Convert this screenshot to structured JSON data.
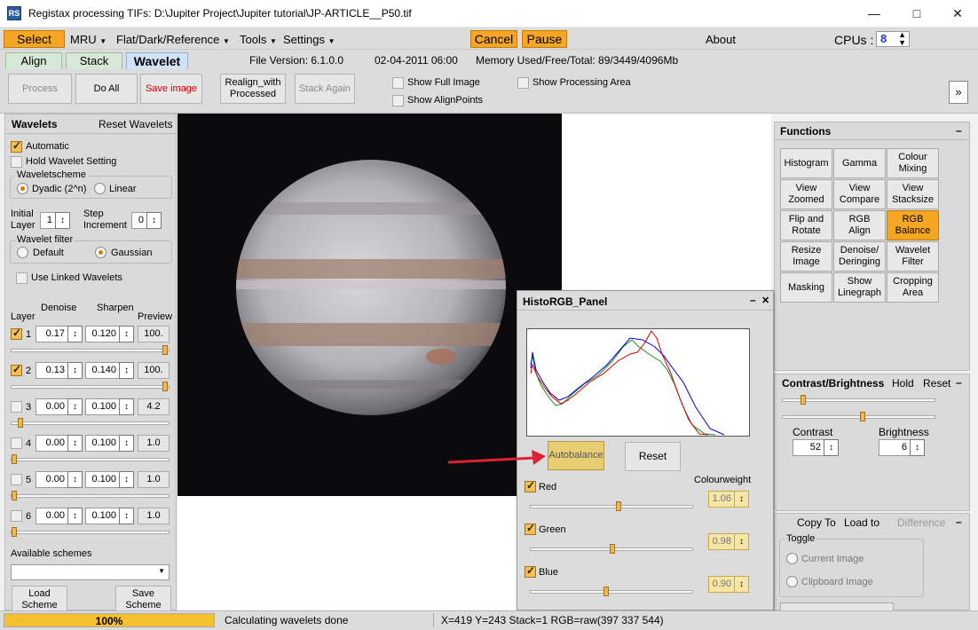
{
  "window": {
    "title": "Registax processing TIFs: D:\\Jupiter Project\\Jupiter tutorial\\JP-ARTICLE__P50.tif",
    "icon_label": "RS"
  },
  "menubar": {
    "select": "Select",
    "mru": "MRU",
    "flat": "Flat/Dark/Reference",
    "tools": "Tools",
    "settings": "Settings",
    "cancel": "Cancel",
    "pause": "Pause",
    "about": "About",
    "cpus_label": "CPUs :",
    "cpus_value": "8"
  },
  "tabs": {
    "align": "Align",
    "stack": "Stack",
    "wavelet": "Wavelet",
    "file_version": "File Version: 6.1.0.0",
    "date": "02-04-2011 06:00",
    "memory": "Memory Used/Free/Total: 89/3449/4096Mb"
  },
  "toolbar": {
    "process": "Process",
    "do_all": "Do All",
    "save_image": "Save image",
    "realign_line1": "Realign_with",
    "realign_line2": "Processed",
    "stack_again": "Stack Again",
    "show_full_image": "Show Full Image",
    "show_alignpoints": "Show AlignPoints",
    "show_processing_area": "Show Processing Area",
    "expand": "»"
  },
  "wavelets": {
    "title": "Wavelets",
    "reset": "Reset Wavelets",
    "automatic": "Automatic",
    "hold": "Hold Wavelet Setting",
    "scheme_title": "Waveletscheme",
    "dyadic": "Dyadic (2^n)",
    "linear": "Linear",
    "initial_layer_1": "Initial",
    "initial_layer_2": "Layer",
    "initial_value": "1",
    "step_1": "Step",
    "step_2": "Increment",
    "step_value": "0",
    "filter_title": "Wavelet filter",
    "default": "Default",
    "gaussian": "Gaussian",
    "use_linked": "Use Linked Wavelets",
    "col_layer": "Layer",
    "col_denoise": "Denoise",
    "col_sharpen": "Sharpen",
    "col_preview": "Preview",
    "layers": [
      {
        "n": "1",
        "denoise": "0.17",
        "sharpen": "0.120",
        "preview": "100.",
        "checked": true,
        "slider": 1.0
      },
      {
        "n": "2",
        "denoise": "0.13",
        "sharpen": "0.140",
        "preview": "100.",
        "checked": true,
        "slider": 1.0
      },
      {
        "n": "3",
        "denoise": "0.00",
        "sharpen": "0.100",
        "preview": "4.2",
        "checked": false,
        "slider": 0.04
      },
      {
        "n": "4",
        "denoise": "0.00",
        "sharpen": "0.100",
        "preview": "1.0",
        "checked": false,
        "slider": 0.0
      },
      {
        "n": "5",
        "denoise": "0.00",
        "sharpen": "0.100",
        "preview": "1.0",
        "checked": false,
        "slider": 0.0
      },
      {
        "n": "6",
        "denoise": "0.00",
        "sharpen": "0.100",
        "preview": "1.0",
        "checked": false,
        "slider": 0.0
      }
    ],
    "available_schemes": "Available schemes",
    "load_1": "Load",
    "load_2": "Scheme",
    "save_1": "Save",
    "save_2": "Scheme"
  },
  "functions": {
    "title": "Functions",
    "collapse": "–",
    "buttons": [
      [
        "Histogram",
        ""
      ],
      [
        "Gamma",
        ""
      ],
      [
        "Colour",
        "Mixing"
      ],
      [
        "View",
        "Zoomed"
      ],
      [
        "View",
        "Compare"
      ],
      [
        "View",
        "Stacksize"
      ],
      [
        "Flip and",
        "Rotate"
      ],
      [
        "RGB",
        "Align"
      ],
      [
        "RGB",
        "Balance"
      ],
      [
        "Resize",
        "Image"
      ],
      [
        "Denoise/",
        "Deringing"
      ],
      [
        "Wavelet",
        "Filter"
      ],
      [
        "Masking",
        ""
      ],
      [
        "Show",
        "Linegraph"
      ],
      [
        "Cropping",
        "Area"
      ]
    ],
    "selected_index": 8
  },
  "contrast": {
    "title": "Contrast/Brightness",
    "hold": "Hold",
    "reset": "Reset",
    "collapse": "–",
    "contrast_label": "Contrast",
    "contrast_value": "52",
    "brightness_label": "Brightness",
    "brightness_value": "6"
  },
  "copy": {
    "copy_to": "Copy To",
    "load_to": "Load to",
    "difference": "Difference",
    "collapse": "–",
    "toggle": "Toggle",
    "current": "Current Image",
    "clipboard": "Clipboard Image"
  },
  "histo": {
    "title": "HistoRGB_Panel",
    "minimize": "–",
    "close": "✕",
    "autobalance": "Autobalance",
    "reset": "Reset",
    "colourweight": "Colourweight",
    "channels": [
      {
        "name": "Red",
        "value": "1.06",
        "slider": 0.53
      },
      {
        "name": "Green",
        "value": "0.98",
        "slider": 0.49
      },
      {
        "name": "Blue",
        "value": "0.90",
        "slider": 0.45
      }
    ],
    "colors": {
      "red": "#d40000",
      "green": "#1a8c1a",
      "blue": "#0000dd"
    }
  },
  "status": {
    "progress": "100%",
    "progress_value": 1.0,
    "message": "Calculating wavelets done",
    "coords": "X=419 Y=243 Stack=1 RGB=raw(397 337 544)"
  }
}
